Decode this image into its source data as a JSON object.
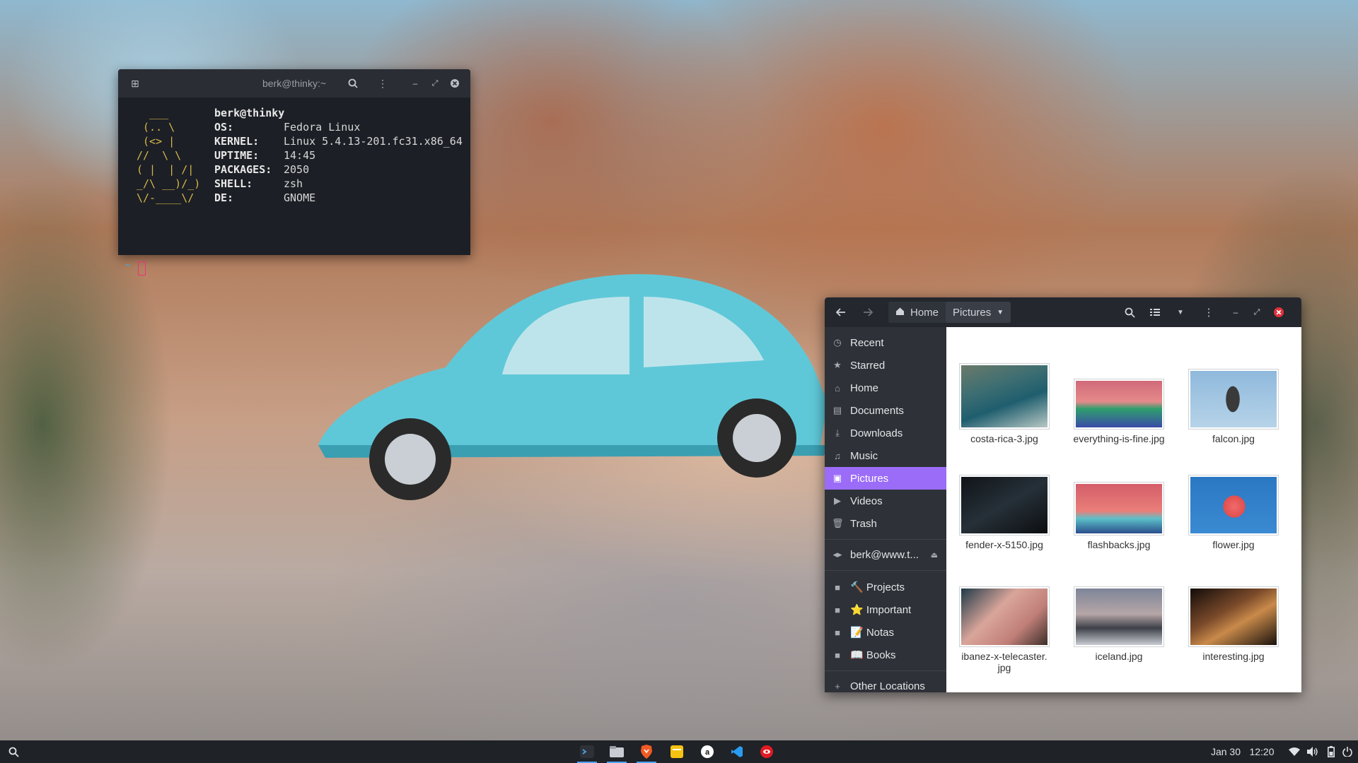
{
  "terminal": {
    "title": "berk@thinky:~",
    "ascii_art": "  ___\n (.. \\\n (<> |\n//  \\ \\\n( |  | /|\n_/\\ __)/_)\n\\/-____\\/",
    "user_host": "berk@thinky",
    "info": [
      {
        "key": "OS:",
        "value": "Fedora Linux"
      },
      {
        "key": "KERNEL:",
        "value": "Linux 5.4.13-201.fc31.x86_64"
      },
      {
        "key": "UPTIME:",
        "value": "14:45"
      },
      {
        "key": "PACKAGES:",
        "value": "2050"
      },
      {
        "key": "SHELL:",
        "value": "zsh"
      },
      {
        "key": "DE:",
        "value": "GNOME"
      }
    ],
    "prompt": "~"
  },
  "files": {
    "breadcrumb": {
      "home": "Home",
      "current": "Pictures"
    },
    "sidebar": {
      "places": [
        {
          "label": "Recent",
          "icon": "clock-icon"
        },
        {
          "label": "Starred",
          "icon": "star-icon"
        },
        {
          "label": "Home",
          "icon": "home-icon"
        },
        {
          "label": "Documents",
          "icon": "document-icon"
        },
        {
          "label": "Downloads",
          "icon": "download-icon"
        },
        {
          "label": "Music",
          "icon": "music-icon"
        },
        {
          "label": "Pictures",
          "icon": "image-icon",
          "selected": true
        },
        {
          "label": "Videos",
          "icon": "video-icon"
        },
        {
          "label": "Trash",
          "icon": "trash-icon"
        }
      ],
      "network": {
        "label": "berk@www.t...",
        "icon": "network-icon"
      },
      "bookmarks": [
        {
          "label": "🔨 Projects",
          "icon": "folder-icon"
        },
        {
          "label": "⭐ Important",
          "icon": "folder-icon"
        },
        {
          "label": "📝 Notas",
          "icon": "folder-icon"
        },
        {
          "label": "📖 Books",
          "icon": "folder-icon"
        }
      ],
      "other": {
        "label": "Other Locations",
        "icon": "plus-icon"
      }
    },
    "items": [
      {
        "name": "costa-rica-3.jpg"
      },
      {
        "name": "everything-is-fine.jpg"
      },
      {
        "name": "falcon.jpg"
      },
      {
        "name": "fender-x-5150.jpg"
      },
      {
        "name": "flashbacks.jpg"
      },
      {
        "name": "flower.jpg"
      },
      {
        "name": "ibanez-x-telecaster.\njpg"
      },
      {
        "name": "iceland.jpg"
      },
      {
        "name": "interesting.jpg"
      }
    ]
  },
  "taskbar": {
    "date": "Jan 30",
    "time": "12:20"
  },
  "colors": {
    "accent": "#9b6cf7",
    "close_red": "#e0323c",
    "panel": "#1f2227"
  }
}
